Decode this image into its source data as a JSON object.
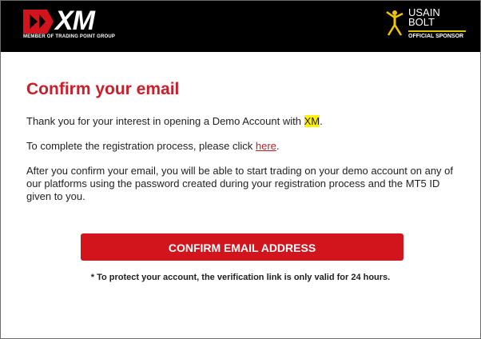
{
  "header": {
    "brand": "XM",
    "brand_tagline": "MEMBER OF TRADING POINT GROUP",
    "sponsor_name_line1": "USAIN",
    "sponsor_name_line2": "BOLT",
    "sponsor_label": "OFFICIAL SPONSOR"
  },
  "email": {
    "title": "Confirm your email",
    "para1_prefix": "Thank you for your interest in opening a Demo Account with ",
    "para1_highlight": "XM",
    "para1_suffix": ".",
    "para2_prefix": "To complete the registration process, please click ",
    "para2_link": "here",
    "para2_suffix": ".",
    "para3": "After you confirm your email, you will be able to start trading on your demo account on any of our platforms using the password created during your registration process and the MT5 ID given to you.",
    "button_label": "CONFIRM EMAIL ADDRESS",
    "note": "* To protect your account, the verification link is only valid for 24 hours."
  },
  "colors": {
    "header_bg": "#000000",
    "title_red": "#c81f2b",
    "button_red": "#d2141d",
    "highlight": "#fff200"
  }
}
